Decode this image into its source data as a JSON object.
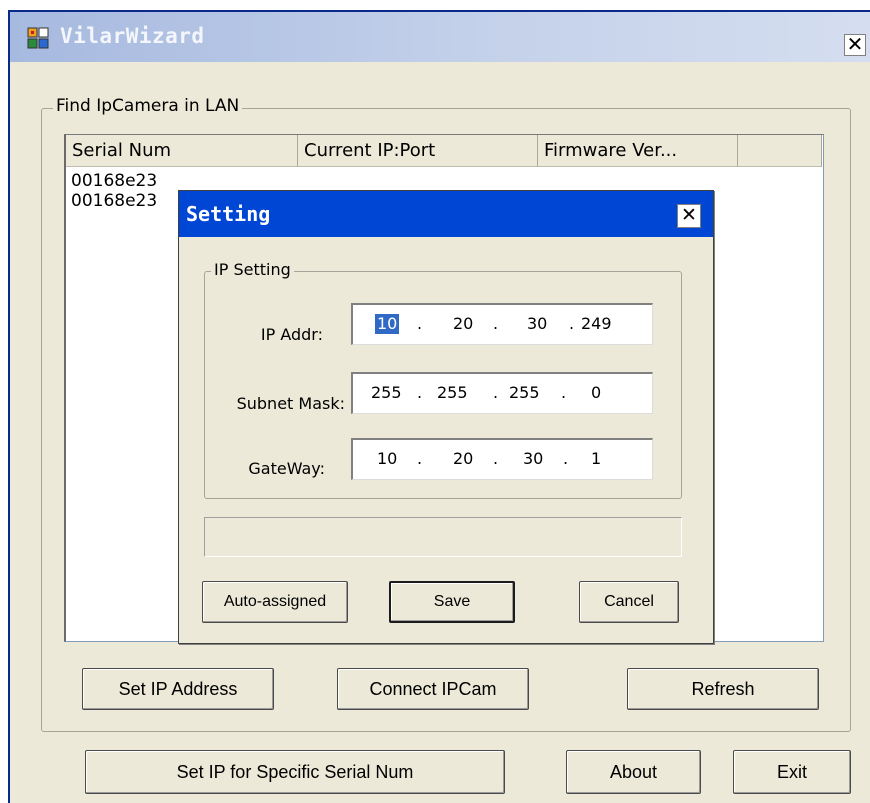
{
  "window": {
    "title": "VilarWizard",
    "close_glyph": "✕"
  },
  "find_group": {
    "legend": "Find IpCamera in LAN",
    "columns": [
      "Serial Num",
      "Current IP:Port",
      "Firmware Ver...",
      ""
    ],
    "rows": [
      {
        "serial": "00168e23",
        "ip": "",
        "fw": ""
      },
      {
        "serial": "00168e23",
        "ip": "",
        "fw": ""
      }
    ],
    "buttons": {
      "set_ip": "Set IP Address",
      "connect": "Connect IPCam",
      "refresh": "Refresh"
    }
  },
  "bottom_buttons": {
    "set_specific": "Set IP for Specific Serial Num",
    "about": "About",
    "exit": "Exit"
  },
  "setting_dialog": {
    "title": "Setting",
    "close_glyph": "✕",
    "group_legend": "IP Setting",
    "fields": [
      {
        "label": "IP Addr:",
        "octets": [
          "10",
          "20",
          "30",
          "249"
        ],
        "selected_octet": 0
      },
      {
        "label": "Subnet Mask:",
        "octets": [
          "255",
          "255",
          "255",
          "0"
        ]
      },
      {
        "label": "GateWay:",
        "octets": [
          "10",
          "20",
          "30",
          "1"
        ]
      }
    ],
    "buttons": {
      "auto": "Auto-assigned",
      "save": "Save",
      "cancel": "Cancel"
    }
  },
  "icons": {
    "app": "app-grid-icon",
    "close": "close-icon"
  },
  "colors": {
    "main_title_gradient_start": "#a6b9df",
    "dialog_title": "#0046d5",
    "selection": "#316ac5",
    "window_bg": "#ece9d8"
  }
}
